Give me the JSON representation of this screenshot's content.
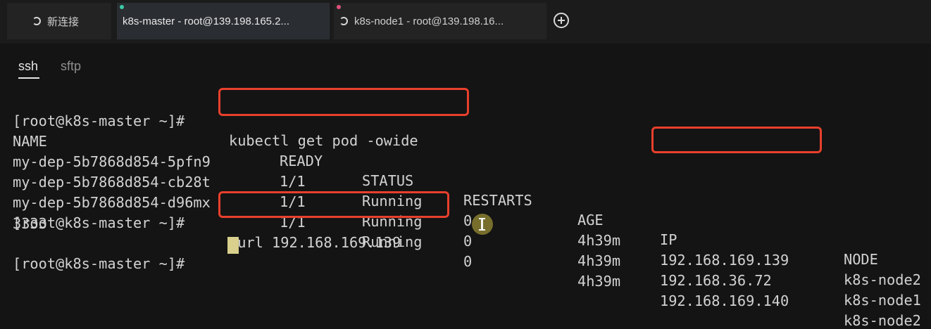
{
  "tabs": [
    {
      "label": "新连接",
      "icon": "spinner-icon",
      "active": false
    },
    {
      "label": "k8s-master - root@139.198.165.2...",
      "icon": "status-dot",
      "active": true,
      "dot_color": "#3cc9a8"
    },
    {
      "label": "k8s-node1 - root@139.198.16...",
      "icon": "spinner-icon",
      "active": false,
      "dot_color": "#e0507a"
    }
  ],
  "new_tab_icon": "plus-circle-icon",
  "subtabs": [
    {
      "label": "ssh",
      "active": true
    },
    {
      "label": "sftp",
      "active": false
    }
  ],
  "terminal": {
    "prompt": "[root@k8s-master ~]#",
    "commands": [
      "kubectl get pod -owide",
      "curl 192.168.169.139"
    ],
    "columns": [
      "NAME",
      "READY",
      "STATUS",
      "RESTARTS",
      "AGE",
      "IP",
      "NODE"
    ],
    "rows": [
      [
        "my-dep-5b7868d854-5pfn9",
        "1/1",
        "Running",
        "0",
        "4h39m",
        "192.168.169.139",
        "k8s-node2"
      ],
      [
        "my-dep-5b7868d854-cb28t",
        "1/1",
        "Running",
        "0",
        "4h39m",
        "192.168.36.72",
        "k8s-node1"
      ],
      [
        "my-dep-5b7868d854-d96mx",
        "1/1",
        "Running",
        "0",
        "4h39m",
        "192.168.169.140",
        "k8s-node2"
      ]
    ],
    "curl_output": "3333"
  },
  "colors": {
    "highlight": "#e8402c",
    "terminal_text": "#d2d2d2",
    "cursor": "#d8d08c"
  }
}
